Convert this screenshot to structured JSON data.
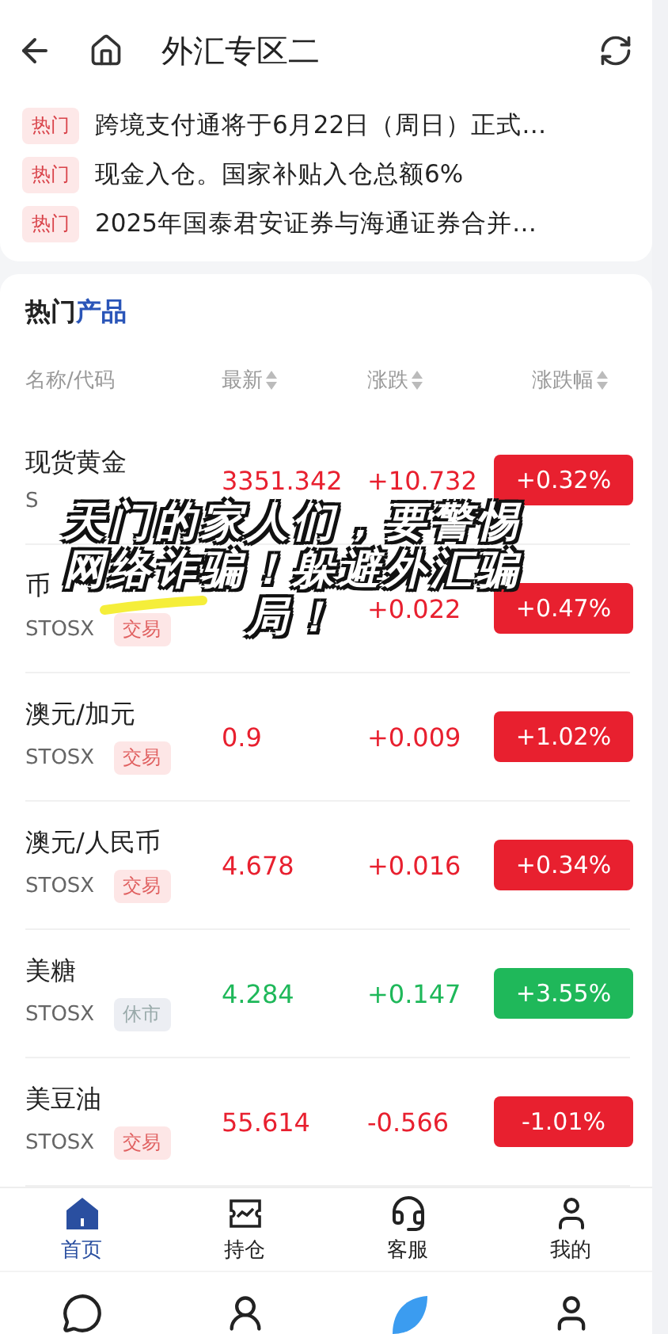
{
  "header": {
    "title": "外汇专区二"
  },
  "news": [
    {
      "tag": "热门",
      "text": "跨境支付通将于6月22日（周日）正式…"
    },
    {
      "tag": "热门",
      "text": "现金入仓。国家补贴入仓总额6%"
    },
    {
      "tag": "热门",
      "text": "2025年国泰君安证券与海通证券合并…"
    }
  ],
  "products": {
    "title_plain": "热门",
    "title_accent": "产品",
    "columns": [
      "名称/代码",
      "最新",
      "涨跌",
      "涨跌幅"
    ],
    "rows": [
      {
        "name": "现货黄金",
        "code": "S",
        "last": "3351.342",
        "change": "+10.732",
        "pct": "+0.32%",
        "color": "#e8202f"
      },
      {
        "name": "币",
        "code": "STOSX",
        "tag": "交易",
        "kind": "trade",
        "change": "+0.022",
        "pct": "+0.47%",
        "color": "#e8202f"
      },
      {
        "name": "澳元/加元",
        "code": "STOSX",
        "tag": "交易",
        "kind": "trade",
        "last": "0.9",
        "change": "+0.009",
        "pct": "+1.02%",
        "color": "#e8202f"
      },
      {
        "name": "澳元/人民币",
        "code": "STOSX",
        "tag": "交易",
        "kind": "trade",
        "last": "4.678",
        "change": "+0.016",
        "pct": "+0.34%",
        "color": "#e8202f"
      },
      {
        "name": "美糖",
        "code": "STOSX",
        "tag": "休市",
        "kind": "closed",
        "last": "4.284",
        "change": "+0.147",
        "pct": "+3.55%",
        "color": "#1fb85a"
      },
      {
        "name": "美豆油",
        "code": "STOSX",
        "tag": "交易",
        "kind": "trade",
        "last": "55.614",
        "change": "-0.566",
        "pct": "-1.01%",
        "color": "#e8202f"
      }
    ]
  },
  "caption_lines": [
    "天门的家人们，要警惕",
    "网络诈骗！躲避外汇骗",
    "局！"
  ],
  "tab_bar": [
    {
      "label": "首页",
      "selected": true
    },
    {
      "label": "持仓",
      "selected": false
    },
    {
      "label": "客服",
      "selected": false
    },
    {
      "label": "我的",
      "selected": false
    }
  ]
}
